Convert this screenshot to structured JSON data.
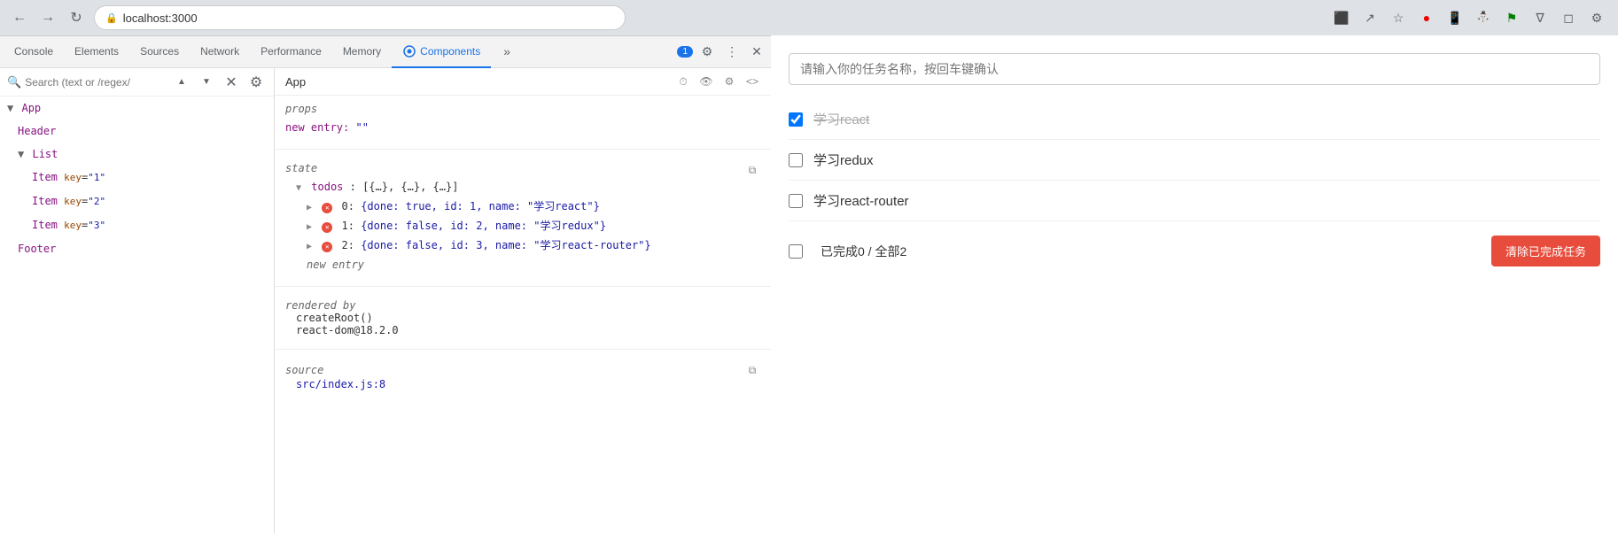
{
  "browser": {
    "address": "localhost:3000",
    "nav": {
      "back": "←",
      "forward": "→",
      "refresh": "↻"
    }
  },
  "devtools": {
    "tabs": [
      {
        "label": "Console",
        "active": false
      },
      {
        "label": "Elements",
        "active": false
      },
      {
        "label": "Sources",
        "active": false
      },
      {
        "label": "Network",
        "active": false
      },
      {
        "label": "Performance",
        "active": false
      },
      {
        "label": "Memory",
        "active": false
      },
      {
        "label": "Components",
        "active": true
      },
      {
        "label": "»",
        "active": false
      }
    ],
    "badge": "1",
    "selected_component": "App",
    "tree": {
      "app_label": "▼ App",
      "header_label": "Header",
      "list_label": "▼ List",
      "item1_label": "Item",
      "item1_key": "\"1\"",
      "item2_label": "Item",
      "item2_key": "\"2\"",
      "item3_label": "Item",
      "item3_key": "\"3\"",
      "footer_label": "Footer"
    },
    "props": {
      "section_title": "props",
      "new_entry_label": "new entry:",
      "new_entry_value": "\"\""
    },
    "state": {
      "section_title": "state",
      "todos_label": "todos",
      "todos_summary": "[{…}, {…}, {…}]",
      "item0": "{done: true, id: 1, name: \"学习react\"}",
      "item1": "{done: false, id: 2, name: \"学习redux\"}",
      "item2": "{done: false, id: 3, name: \"学习react-router\"}",
      "new_entry": "new entry"
    },
    "rendered_by": {
      "section_title": "rendered by",
      "line1": "createRoot()",
      "line2": "react-dom@18.2.0"
    },
    "source": {
      "section_title": "source",
      "value": "src/index.js:8"
    }
  },
  "todo_app": {
    "input_placeholder": "请输入你的任务名称，按回车键确认",
    "todos": [
      {
        "id": 1,
        "text": "学习react",
        "done": true
      },
      {
        "id": 2,
        "text": "学习redux",
        "done": false
      },
      {
        "id": 3,
        "text": "学习react-router",
        "done": false
      }
    ],
    "footer": {
      "all_checkbox_checked": false,
      "count_text": "已完成0 / 全部2",
      "clear_btn_label": "清除已完成任务"
    }
  },
  "icons": {
    "close": "✕",
    "gear": "⚙",
    "more": "⋮",
    "copy": "⧉",
    "timer": "⏱",
    "eye": "👁",
    "code": "<>",
    "search": "🔍",
    "circle_x": "✕",
    "up_arrow": "▲",
    "down_arrow": "▼",
    "right_arrow": "▶"
  }
}
